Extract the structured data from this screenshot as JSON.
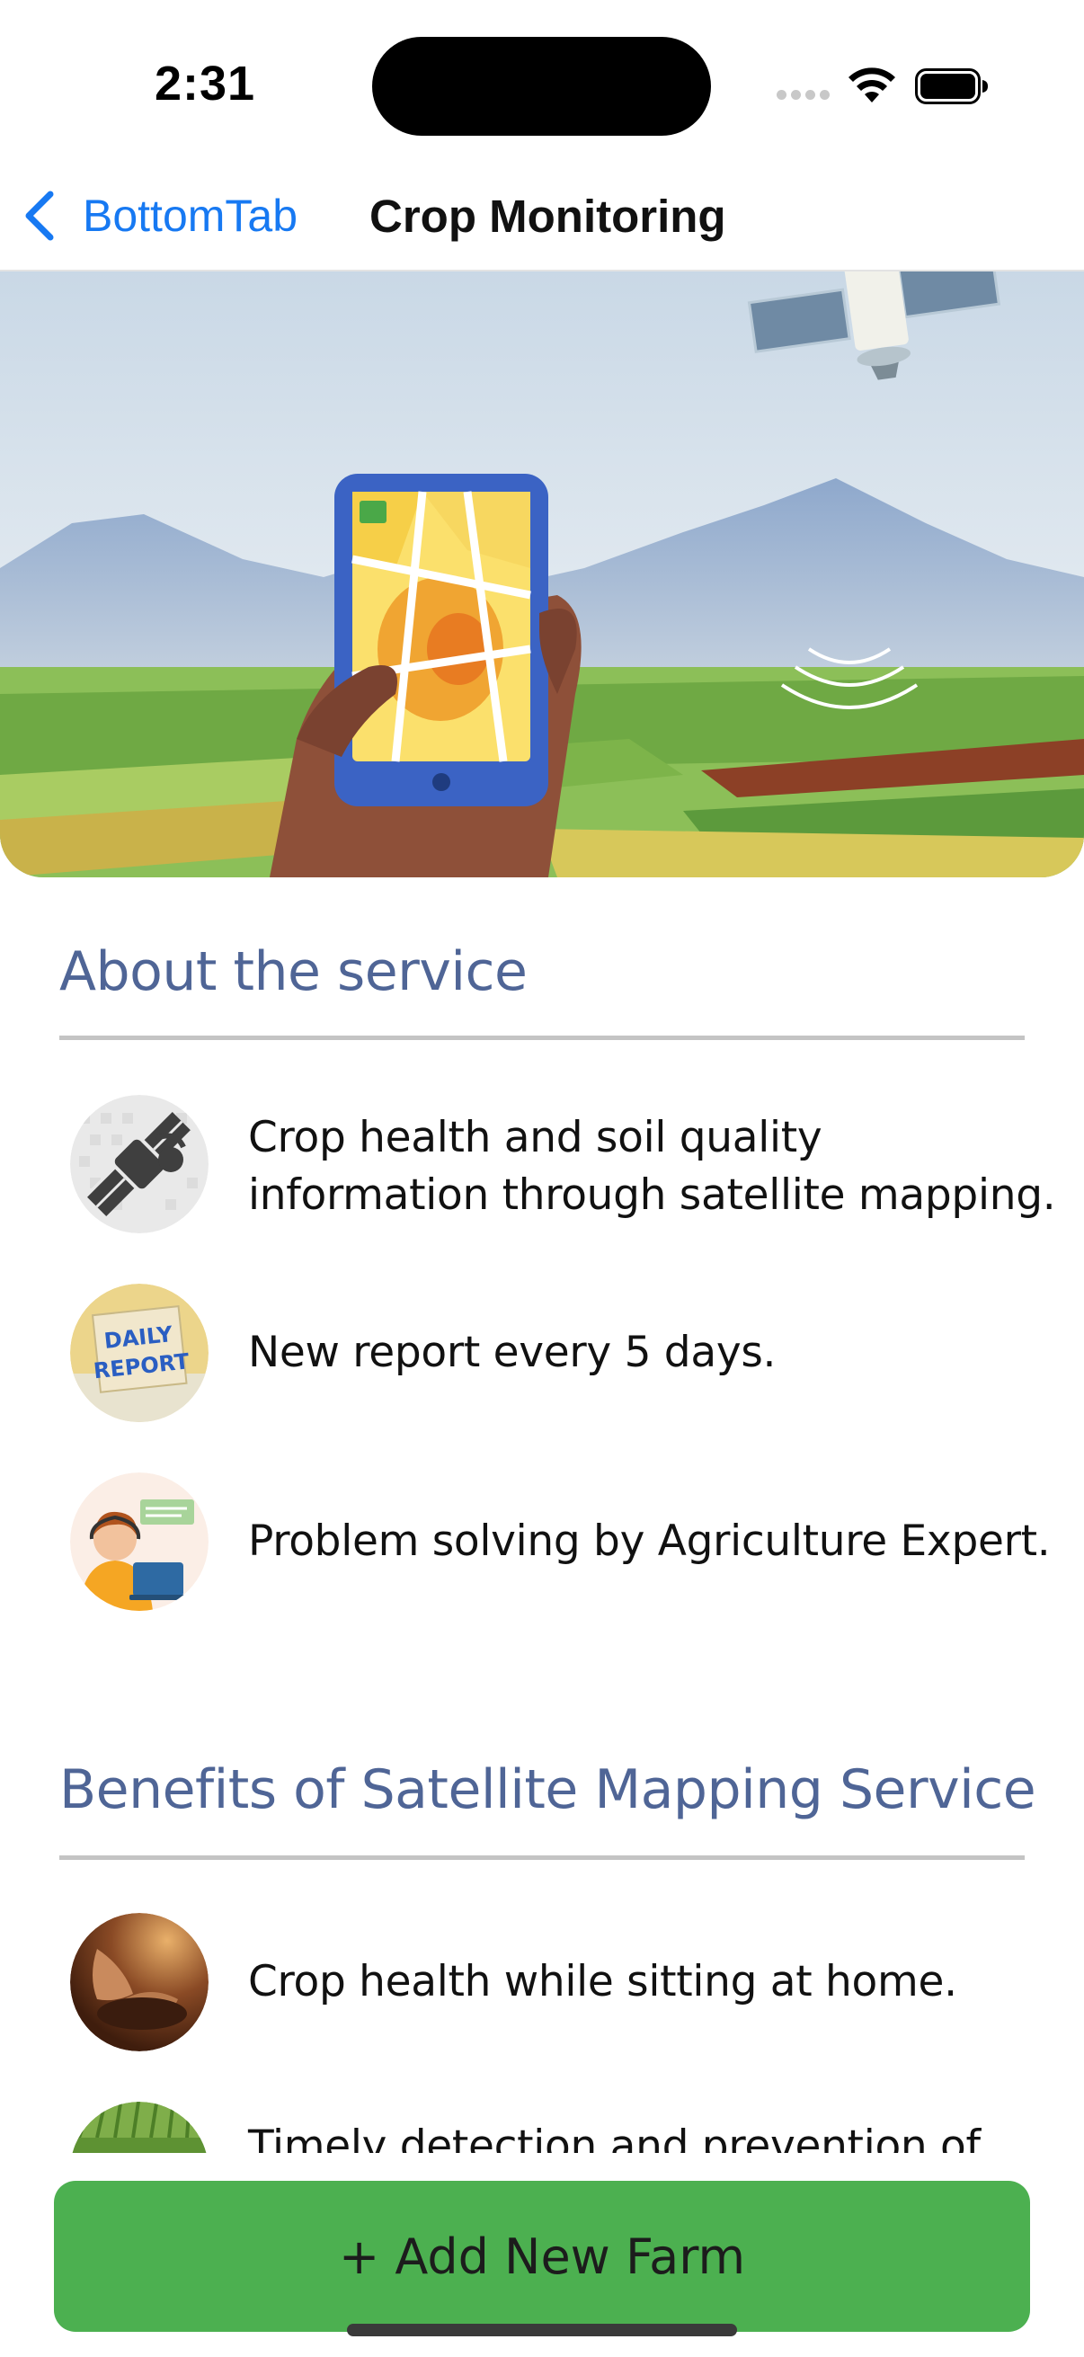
{
  "status_bar": {
    "time": "2:31",
    "icons": [
      "cellular-signal-icon",
      "wifi-icon",
      "battery-icon"
    ]
  },
  "nav": {
    "back_label": "BottomTab",
    "title": "Crop Monitoring"
  },
  "about": {
    "title": "About the service",
    "items": [
      {
        "text_lines": [
          "Crop health and soil quality",
          "information through satellite mapping."
        ],
        "icon": "satellite-icon"
      },
      {
        "text_lines": [
          "New report every 5 days."
        ],
        "icon": "daily-report-icon",
        "icon_text": [
          "DAILY",
          "REPORT"
        ]
      },
      {
        "text_lines": [
          "Problem solving by Agriculture Expert."
        ],
        "icon": "expert-icon"
      }
    ]
  },
  "benefits": {
    "title": "Benefits of Satellite Mapping Service",
    "items": [
      {
        "text_lines": [
          "Crop health while sitting at home."
        ],
        "icon": "soil-hands-icon"
      },
      {
        "text_lines": [
          "Timely detection and prevention of"
        ],
        "icon": "crop-field-icon"
      }
    ]
  },
  "footer": {
    "add_button_label": "+ Add New Farm"
  },
  "colors": {
    "accent_blue": "#1779f2",
    "section_title": "#4f6596",
    "button_green": "#4cb050",
    "divider": "#c4c4c4"
  }
}
